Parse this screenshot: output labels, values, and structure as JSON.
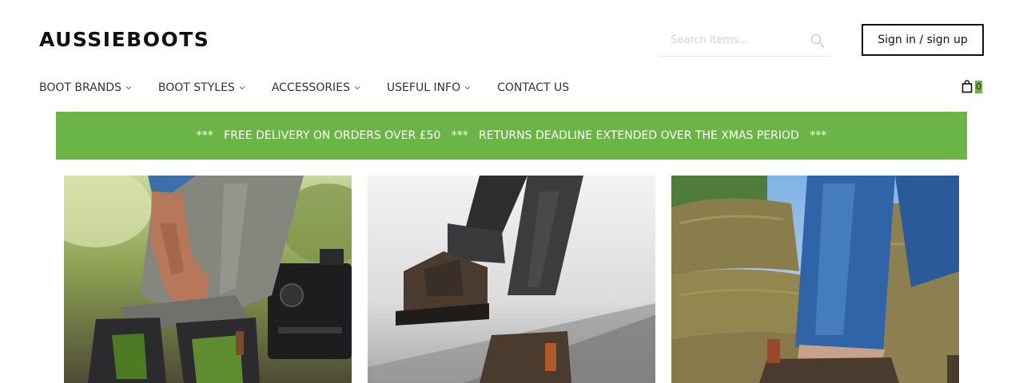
{
  "brand": {
    "logo_text": "AUSSIEBOOTS"
  },
  "search": {
    "placeholder": "Search items..."
  },
  "account": {
    "signin_label": "Sign in / sign up"
  },
  "nav": {
    "items": [
      {
        "label": "BOOT BRANDS",
        "has_dropdown": true
      },
      {
        "label": "BOOT STYLES",
        "has_dropdown": true
      },
      {
        "label": "ACCESSORIES",
        "has_dropdown": true
      },
      {
        "label": "USEFUL INFO",
        "has_dropdown": true
      },
      {
        "label": "CONTACT US",
        "has_dropdown": false
      }
    ]
  },
  "cart": {
    "icon": "shopping-bag-icon",
    "count": "0"
  },
  "banner": {
    "text": "***   FREE DELIVERY ON ORDERS OVER £50   ***   RETURNS DEADLINE EXTENDED OVER THE XMAS PERIOD   ***"
  },
  "colors": {
    "accent_green": "#6bb546",
    "text_dark": "#111111",
    "nav_text": "#333333"
  },
  "tiles": [
    {
      "image": "man pulling up grey trousers over dark boots with green elastic, camera equipment behind"
    },
    {
      "image": "person in grey jeans wearing brown chelsea boots walking on pavement"
    },
    {
      "image": "person in frayed blue jeans wearing brown boots beside hessian sandbags"
    }
  ]
}
